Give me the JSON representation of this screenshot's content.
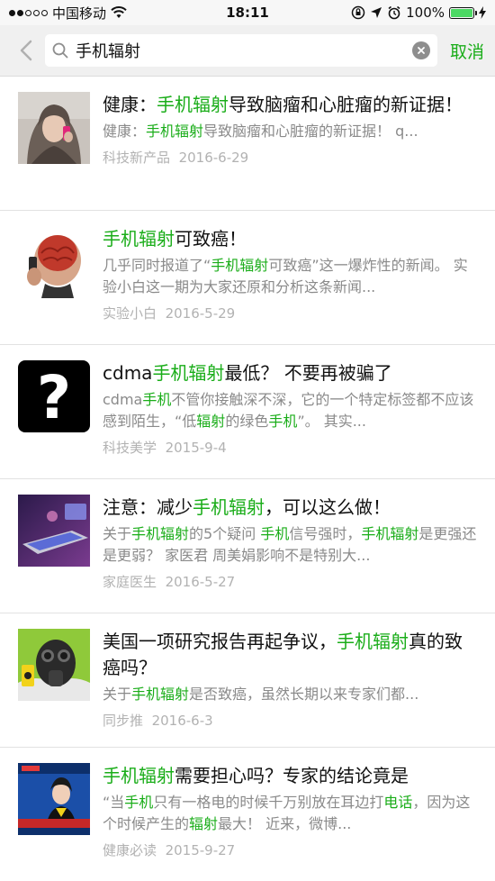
{
  "status_bar": {
    "carrier": "中国移动",
    "time": "18:11",
    "battery": "100%",
    "battery_level": 1.0
  },
  "search": {
    "query": "手机辐射",
    "cancel_label": "取消"
  },
  "colors": {
    "highlight": "#1aad19",
    "meta": "#b2b2b2",
    "desc": "#8a8a8a"
  },
  "results": [
    {
      "title_parts": [
        "健康：",
        "手机辐射",
        "导致脑瘤和心脏瘤的新证据！"
      ],
      "desc_parts": [
        "健康：",
        "手机辐射",
        "导致脑瘤和心脏瘤的新证据！ q..."
      ],
      "source": "科技新产品",
      "date": "2016-6-29",
      "thumb_icon": "woman-phone-photo"
    },
    {
      "title_parts": [
        "",
        "手机辐射",
        "可致癌！"
      ],
      "desc_parts": [
        "几乎同时报道了“",
        "手机辐射",
        "可致癌”这一爆炸性的新闻。 实验小白这一期为大家还原和分析这条新闻..."
      ],
      "source": "实验小白",
      "date": "2016-5-29",
      "thumb_icon": "brain-radiation-photo"
    },
    {
      "title_parts": [
        "cdma",
        "手机辐射",
        "最低？ 不要再被骗了"
      ],
      "desc_parts": [
        "cdma",
        "手机",
        "不管你接触深不深，它的一个特定标签都不应该感到陌生，“低",
        "辐射",
        "的绿色",
        "手机",
        "”。 其实..."
      ],
      "source": "科技美学",
      "date": "2015-9-4",
      "thumb_icon": "question-mark-icon"
    },
    {
      "title_parts": [
        "注意：减少",
        "手机辐射",
        "，可以这么做！"
      ],
      "desc_parts": [
        "关于",
        "手机辐射",
        "的5个疑问 ",
        "手机",
        "信号强时，",
        "手机辐射",
        "是更强还是更弱？ 家医君 周美娟影响不是特别大..."
      ],
      "source": "家庭医生",
      "date": "2016-5-27",
      "thumb_icon": "phone-screen-photo"
    },
    {
      "title_parts": [
        "美国一项研究报告再起争议，",
        "手机辐射",
        "真的致癌吗？"
      ],
      "desc_parts": [
        "关于",
        "手机辐射",
        "是否致癌，虽然长期以来专家们都..."
      ],
      "source": "同步推",
      "date": "2016-6-3",
      "thumb_icon": "gas-mask-photo"
    },
    {
      "title_parts": [
        "",
        "手机辐射",
        "需要担心吗？专家的结论竟是"
      ],
      "desc_parts": [
        "“当",
        "手机",
        "只有一格电的时候千万别放在耳边打",
        "电话",
        "，因为这个时候产生的",
        "辐射",
        "最大！ 近来，微博..."
      ],
      "source": "健康必读",
      "date": "2015-9-27",
      "thumb_icon": "news-anchor-photo"
    }
  ]
}
